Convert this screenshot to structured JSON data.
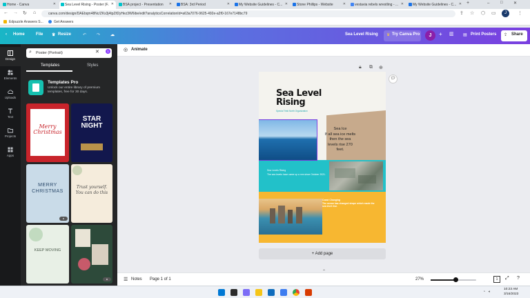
{
  "browser": {
    "tabs": [
      {
        "label": "Home - Canva",
        "color": "#00c4cc"
      },
      {
        "label": "Sea Level Rising - Poster (F...",
        "color": "#00c4cc"
      },
      {
        "label": "BSA project - Presentation",
        "color": "#00c4cc"
      },
      {
        "label": "BSA: 3rd Period",
        "color": "#1a73e8"
      },
      {
        "label": "My Website Guidelines - C...",
        "color": "#1a73e8"
      },
      {
        "label": "Stone Phillips - Website",
        "color": "#1a73e8"
      },
      {
        "label": "vestavia rebels wrestling - ...",
        "color": "#4285f4"
      },
      {
        "label": "My Website Guidelines - C...",
        "color": "#1a73e8"
      }
    ],
    "new_tab": "+",
    "url": "canva.com/design/DAEbqm48Nc/ZKs3j4tpZif2yHez3W6ibe/edit?analyticsCorrelationId=a63a7076-9625-492e-a2f0-167e7148bc79",
    "bookmarks": [
      "Edpuzzle Answers S...",
      "Get Answers"
    ],
    "profile_initial": "J"
  },
  "header": {
    "home": "Home",
    "file": "File",
    "resize": "Resize",
    "design_title": "Sea Level Rising",
    "try_pro": "Try Canva Pro",
    "user_initial": "J",
    "print": "Print Posters",
    "share": "Share"
  },
  "rail": [
    {
      "label": "Design",
      "icon": "layout-icon"
    },
    {
      "label": "Elements",
      "icon": "shapes-icon"
    },
    {
      "label": "Uploads",
      "icon": "upload-cloud-icon"
    },
    {
      "label": "Text",
      "icon": "text-t-icon"
    },
    {
      "label": "Projects",
      "icon": "folder-icon"
    },
    {
      "label": "Apps",
      "icon": "apps-grid-icon"
    }
  ],
  "panel": {
    "search_value": "Poster (Portrait)",
    "filter_badge": "1",
    "tabs": [
      "Templates",
      "Styles"
    ],
    "pro_title": "Templates Pro",
    "pro_desc": "Unlock our entire library of premium templates, free for 30 days.",
    "thumbs": [
      {
        "text": "Merry Christmas",
        "bg": "#c8242b"
      },
      {
        "text": "STAR NIGHT",
        "bg": "#12174d"
      },
      {
        "text": "MERRY CHRISTMAS",
        "bg": "#c9dbe8"
      },
      {
        "text": "Trust yourself. You can do this",
        "bg": "#f5ecdc"
      },
      {
        "text": "KEEP MOVING",
        "bg": "#e8f0e6"
      },
      {
        "text": "",
        "bg": "#2d4a3a"
      }
    ]
  },
  "toolbar": {
    "animate": "Animate"
  },
  "poster": {
    "title_line1": "Sea Level",
    "title_line2": "Rising",
    "subtitle": "Special Tristi North Organization",
    "callout": "Sea Ice\nIf all sea ice melts\nthen the sea\nlevels rise 270\nfeet.",
    "body1_title": "Sea Levels Rising",
    "body1_text": "The sea levels have came up a mm since October 2021.",
    "body2_title": "Coast Changing",
    "body2_text": "The ocean has changed shape which made the sea level rise."
  },
  "add_page": "+ Add page",
  "footer": {
    "notes": "Notes",
    "page": "Page 1 of 1",
    "zoom": "27%",
    "zoom_level": 0.27
  },
  "taskbar": {
    "time": "10:23 AM",
    "date": "3/16/2023"
  }
}
